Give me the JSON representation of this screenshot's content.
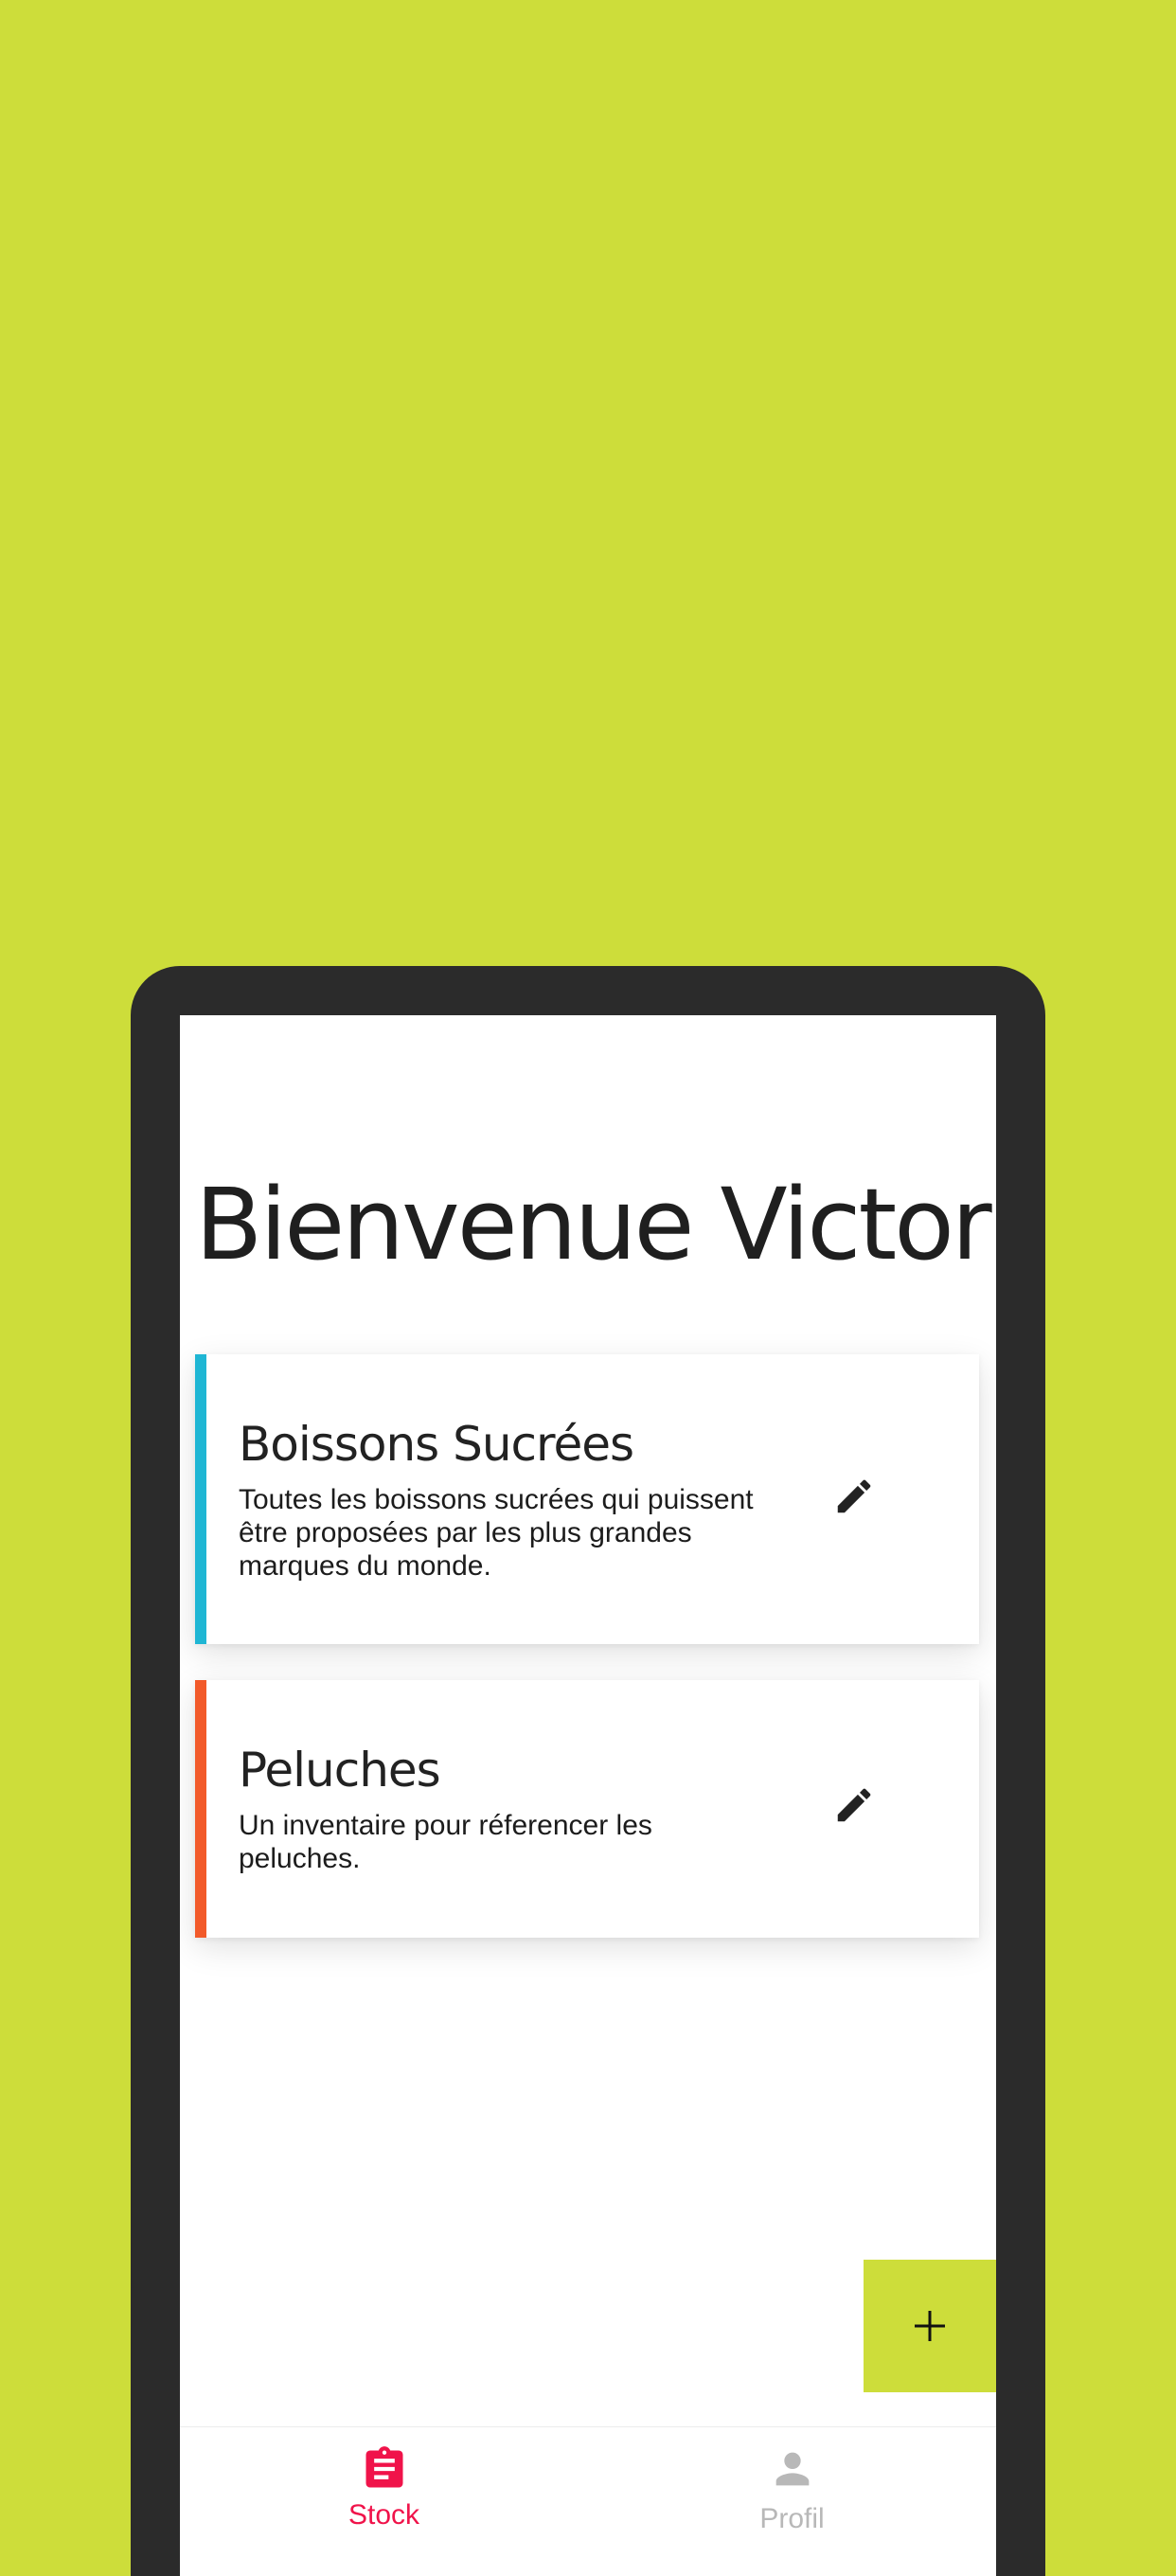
{
  "colors": {
    "background": "#cddd3a",
    "device_frame": "#2b2b2b",
    "active_tab": "#f0134a",
    "inactive_tab": "#b8b8b8",
    "fab": "#cddd3a"
  },
  "home": {
    "greeting": "Bienvenue Victor"
  },
  "inventories": [
    {
      "title": "Boissons Sucrées",
      "description": "Toutes les boissons sucrées qui puissent être proposées par les plus grandes marques du monde.",
      "accent_color": "#1fb6d4",
      "action_icon": "pencil-icon"
    },
    {
      "title": "Peluches",
      "description": "Un inventaire pour réferencer les peluches.",
      "accent_color": "#f25a2a",
      "action_icon": "pencil-icon"
    }
  ],
  "fab": {
    "icon": "plus-icon"
  },
  "bottom_nav": {
    "items": [
      {
        "label": "Stock",
        "icon": "clipboard-icon",
        "active": true
      },
      {
        "label": "Profil",
        "icon": "person-icon",
        "active": false
      }
    ]
  }
}
